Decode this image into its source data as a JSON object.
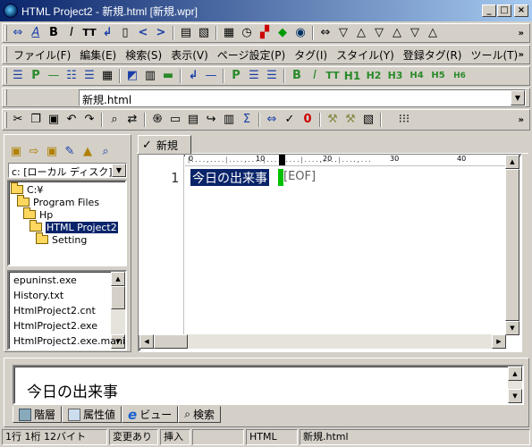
{
  "window": {
    "title": "HTML Project2 - 新規.html [新規.wpr]"
  },
  "menu": [
    "ファイル(F)",
    "編集(E)",
    "検索(S)",
    "表示(V)",
    "ページ設定(P)",
    "タグ(I)",
    "スタイル(Y)",
    "登録タグ(R)",
    "ツール(T)"
  ],
  "format_toolbar": {
    "bold": "B",
    "italic": "I",
    "tt": "TT",
    "h1": "H1",
    "h2": "H2",
    "h3": "H3",
    "h4": "H4",
    "h5": "H5",
    "h6": "H6",
    "p": "P"
  },
  "top_toolbar": {
    "bold": "B",
    "italic": "I",
    "tt": "TT"
  },
  "file_combo": {
    "value": "新規.html"
  },
  "drive_combo": {
    "value": "c: [ローカル ディスク]"
  },
  "tree": [
    {
      "label": "C:¥",
      "indent": 0
    },
    {
      "label": "Program Files",
      "indent": 1
    },
    {
      "label": "Hp",
      "indent": 2
    },
    {
      "label": "HTML Project2",
      "indent": 3,
      "selected": true
    },
    {
      "label": "Setting",
      "indent": 4
    }
  ],
  "files": [
    "epuninst.exe",
    "History.txt",
    "HtmlProject2.cnt",
    "HtmlProject2.exe",
    "HtmlProject2.exe.mani"
  ],
  "editor": {
    "tab_label": "新規",
    "line_number": "1",
    "text": "今日の出来事",
    "eof_marker": "[EOF]",
    "ruler": [
      "0",
      "10",
      "20",
      "30",
      "40"
    ]
  },
  "preview": {
    "text": "今日の出来事"
  },
  "bottom_tabs": [
    "階層",
    "属性値",
    "ビュー",
    "検索"
  ],
  "status": {
    "position": "1行 1桁 12バイト",
    "modified": "変更あり",
    "mode": "挿入",
    "blank": "",
    "type": "HTML",
    "file": "新規.html"
  }
}
